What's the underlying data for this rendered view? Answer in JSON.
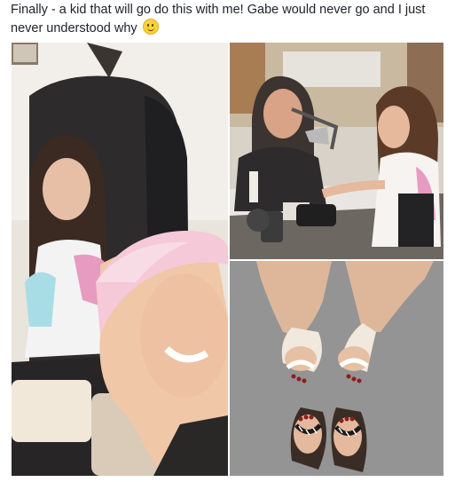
{
  "post": {
    "text": "Finally - a kid that will go do this with me! Gabe would never go and I just never understood why",
    "emoji_icon": "smiley-emoji-icon"
  },
  "photos": [
    {
      "name": "selfie-pedicure-chairs-photo"
    },
    {
      "name": "manicure-station-photo"
    },
    {
      "name": "painted-toes-flip-flops-photo"
    }
  ]
}
